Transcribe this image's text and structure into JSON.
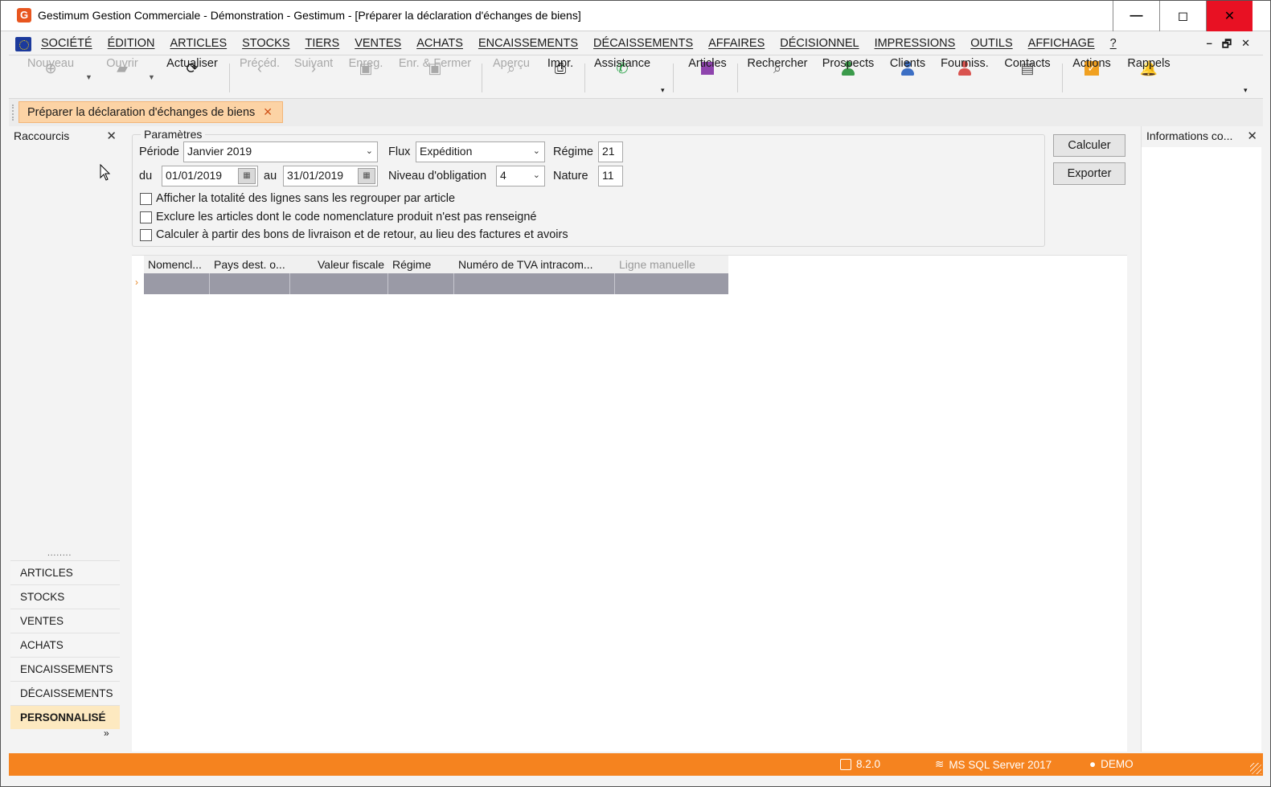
{
  "window": {
    "title": "Gestimum Gestion Commerciale - Démonstration - Gestimum - [Préparer la déclaration d'échanges de biens]",
    "app_icon": "G",
    "controls": {
      "minimize": "—",
      "maximize": "◻",
      "close": "✕"
    }
  },
  "menu": {
    "items": [
      "SOCIÉTÉ",
      "ÉDITION",
      "ARTICLES",
      "STOCKS",
      "TIERS",
      "VENTES",
      "ACHATS",
      "ENCAISSEMENTS",
      "DÉCAISSEMENTS",
      "AFFAIRES",
      "DÉCISIONNEL",
      "IMPRESSIONS",
      "OUTILS",
      "AFFICHAGE",
      "?"
    ],
    "mdi_controls": {
      "minimize": "–",
      "restore": "🗗",
      "close": "✕"
    }
  },
  "toolbar": {
    "nouveau": "Nouveau",
    "ouvrir": "Ouvrir",
    "actualiser": "Actualiser",
    "preced": "Précéd.",
    "suivant": "Suivant",
    "enreg": "Enreg.",
    "enr_fermer": "Enr. & Fermer",
    "apercu": "Aperçu",
    "impr": "Impr.",
    "assistance": "Assistance",
    "articles": "Articles",
    "rechercher": "Rechercher",
    "prospects": "Prospects",
    "clients": "Clients",
    "fourniss": "Fourniss.",
    "contacts": "Contacts",
    "actions": "Actions",
    "rappels": "Rappels",
    "colors": {
      "articles": "#8e44ad",
      "prospects": "#3a9a4a",
      "clients": "#3c6fc4",
      "fourniss": "#d9534f",
      "contacts": "#555555",
      "actions": "#f0a020",
      "rappels": "#f08a20",
      "assistance": "#25a244"
    }
  },
  "tab": {
    "label": "Préparer la déclaration d'échanges de biens",
    "close": "✕"
  },
  "left_panel": {
    "title": "Raccourcis",
    "close": "✕",
    "dots": "........",
    "nav": [
      "ARTICLES",
      "STOCKS",
      "VENTES",
      "ACHATS",
      "ENCAISSEMENTS",
      "DÉCAISSEMENTS",
      "PERSONNALISÉ"
    ],
    "active": "PERSONNALISÉ",
    "more": "»"
  },
  "params": {
    "legend": "Paramètres",
    "periode_label": "Période",
    "periode_value": "Janvier 2019",
    "du_label": "du",
    "du_value": "01/01/2019",
    "au_label": "au",
    "au_value": "31/01/2019",
    "flux_label": "Flux",
    "flux_value": "Expédition",
    "niveau_label": "Niveau d'obligation",
    "niveau_value": "4",
    "regime_label": "Régime",
    "regime_value": "21",
    "nature_label": "Nature",
    "nature_value": "11",
    "checkboxes": [
      "Afficher la totalité des lignes sans les regrouper par article",
      "Exclure les articles dont le code nomenclature produit n'est pas renseigné",
      "Calculer à partir des bons de livraison et de retour, au lieu des factures et avoirs"
    ],
    "calculer": "Calculer",
    "exporter": "Exporter"
  },
  "grid": {
    "columns": [
      "Nomencl...",
      "Pays dest. o...",
      "Valeur fiscale",
      "Régime",
      "Numéro de TVA intracom...",
      "Ligne manuelle"
    ]
  },
  "right_panel": {
    "title": "Informations co...",
    "close": "✕"
  },
  "status": {
    "version": "8.2.0",
    "server": "MS SQL Server 2017",
    "user": "DEMO"
  }
}
